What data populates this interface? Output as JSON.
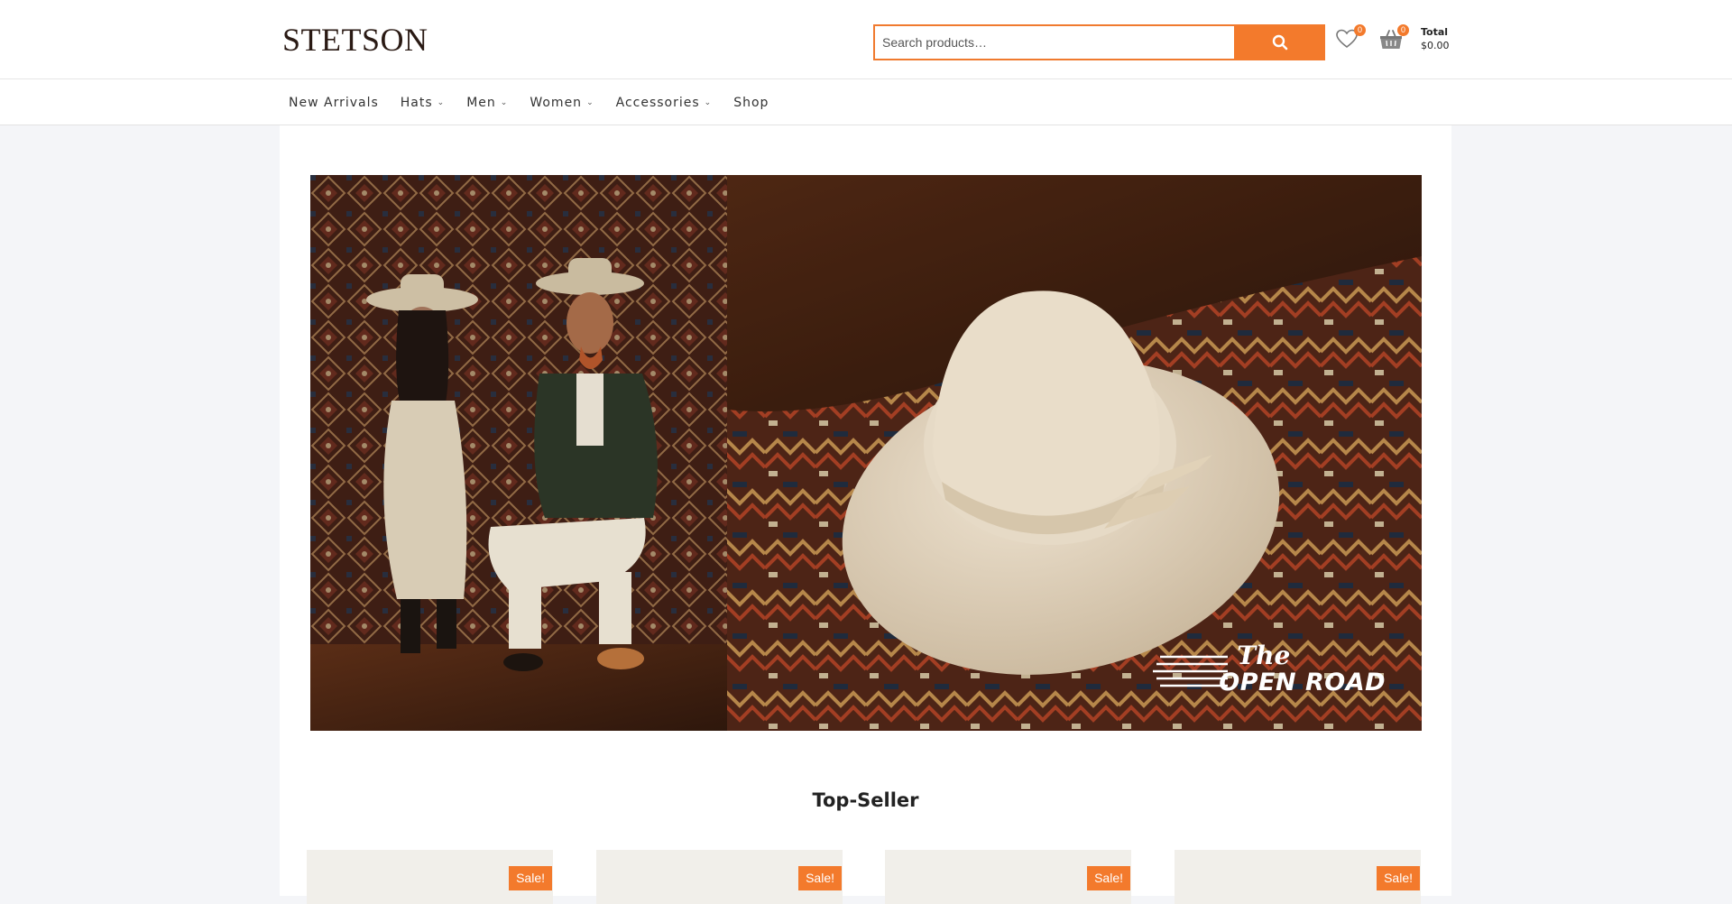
{
  "brand": {
    "logo_text": "STETSON"
  },
  "search": {
    "placeholder": "Search products…",
    "value": ""
  },
  "header": {
    "wishlist_count": "0",
    "cart_count": "0",
    "total_label": "Total",
    "total_value": "$0.00"
  },
  "nav": {
    "items": [
      {
        "label": "New Arrivals",
        "has_dropdown": false
      },
      {
        "label": "Hats",
        "has_dropdown": true
      },
      {
        "label": "Men",
        "has_dropdown": true
      },
      {
        "label": "Women",
        "has_dropdown": true
      },
      {
        "label": "Accessories",
        "has_dropdown": true
      },
      {
        "label": "Shop",
        "has_dropdown": false
      }
    ]
  },
  "hero": {
    "logo_the": "The",
    "logo_road": "OPEN ROAD"
  },
  "section": {
    "title": "Top-Seller"
  },
  "products": [
    {
      "badge": "Sale!"
    },
    {
      "badge": "Sale!"
    },
    {
      "badge": "Sale!"
    },
    {
      "badge": "Sale!"
    }
  ],
  "icons": {
    "search": "search-icon",
    "wishlist": "heart-icon",
    "cart": "basket-icon",
    "dropdown": "chevron-down-icon"
  },
  "colors": {
    "accent": "#f37a2c",
    "brand_text": "#2a1a14"
  }
}
